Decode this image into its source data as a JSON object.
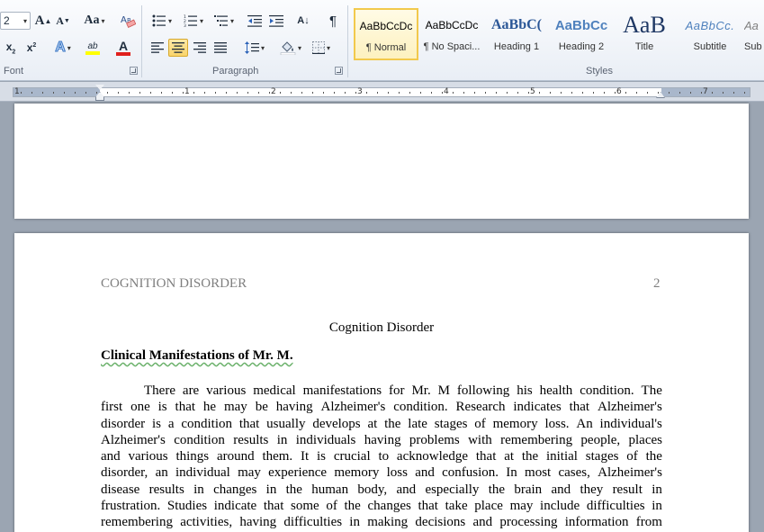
{
  "ribbon": {
    "font": {
      "size_value": "2",
      "grow_label": "A",
      "shrink_label": "A",
      "change_case_label": "Aa",
      "subscript_label": "x",
      "superscript_label": "x",
      "text_effects_label": "A",
      "highlight_label": "ab",
      "font_color_label": "A",
      "group_label": "Font"
    },
    "paragraph": {
      "sort_label": "A↓",
      "show_marks_label": "¶",
      "group_label": "Paragraph"
    },
    "styles": {
      "group_label": "Styles",
      "items": [
        {
          "preview": "AaBbCcDc",
          "name": "¶ Normal"
        },
        {
          "preview": "AaBbCcDc",
          "name": "¶ No Spaci..."
        },
        {
          "preview": "AaBbC(",
          "name": "Heading 1"
        },
        {
          "preview": "AaBbCc",
          "name": "Heading 2"
        },
        {
          "preview": "AaB",
          "name": "Title"
        },
        {
          "preview": "AaBbCc.",
          "name": "Subtitle"
        },
        {
          "preview": "Aa",
          "name": "Sub"
        }
      ]
    }
  },
  "ruler": {
    "numbers": [
      "1",
      "1",
      "2",
      "3",
      "4",
      "5",
      "6",
      "7"
    ]
  },
  "document": {
    "running_head": "COGNITION DISORDER",
    "page_number": "2",
    "title": "Cognition Disorder",
    "heading": "Clinical Manifestations  of Mr. M.",
    "body_lines": [
      "There are various medical manifestations for Mr. M following his health condition. The",
      "first one is that he may be having Alzheimer's  condition. Research indicates that Alzheimer's",
      "disorder is  a condition that usually develops at the late stages of memory loss.  An individual's",
      "Alzheimer's  condition results in individuals having problems  with remembering  people, places",
      "and various things around them. It is crucial  to acknowledge that at the initial stages of the",
      "disorder, an individual may experience memory loss and confusion. In most cases, Alzheimer's",
      "disease results in changes in the human body, and especially  the brain and they result in",
      "frustration. Studies indicate that some of the changes that take place may include difficulties in",
      "remembering  activities,  having difficulties in making decisions and processing  information from"
    ]
  },
  "colors": {
    "ribbon_bg": "#e9eef5",
    "selected_style": "#f2c94c",
    "active_button": "#f9d46a",
    "workspace": "#9ba5b2",
    "running_head": "#7f7f7f"
  }
}
